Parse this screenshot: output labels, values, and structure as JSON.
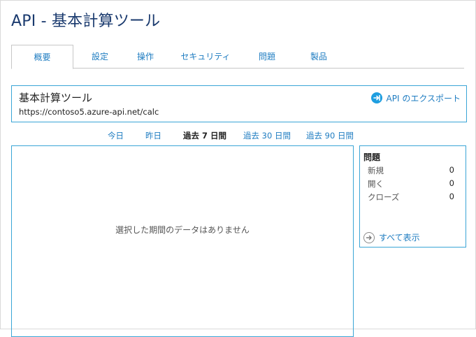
{
  "page": {
    "title": "API - 基本計算ツール"
  },
  "tabs": [
    {
      "label": "概要",
      "active": true
    },
    {
      "label": "設定",
      "active": false
    },
    {
      "label": "操作",
      "active": false
    },
    {
      "label": "セキュリティ",
      "active": false
    },
    {
      "label": "問題",
      "active": false
    },
    {
      "label": "製品",
      "active": false
    }
  ],
  "api": {
    "name": "基本計算ツール",
    "url": "https://contoso5.azure-api.net/calc",
    "export_label": "API のエクスポート",
    "export_icon": "export-arrow-icon"
  },
  "time_ranges": [
    {
      "label": "今日",
      "active": false
    },
    {
      "label": "昨日",
      "active": false
    },
    {
      "label": "過去 7 日間",
      "active": true
    },
    {
      "label": "過去 30 日間",
      "active": false
    },
    {
      "label": "過去 90 日間",
      "active": false
    }
  ],
  "chart_panel": {
    "empty_message": "選択した期間のデータはありません"
  },
  "issues": {
    "title": "問題",
    "rows": [
      {
        "label": "新規",
        "count": "0"
      },
      {
        "label": "開く",
        "count": "0"
      },
      {
        "label": "クローズ",
        "count": "0"
      }
    ],
    "show_all_label": "すべて表示",
    "show_all_icon": "arrow-right-circle-icon"
  },
  "colors": {
    "accent": "#1e7cc1",
    "border_accent": "#3aa5d6",
    "title": "#1a3a6e"
  }
}
